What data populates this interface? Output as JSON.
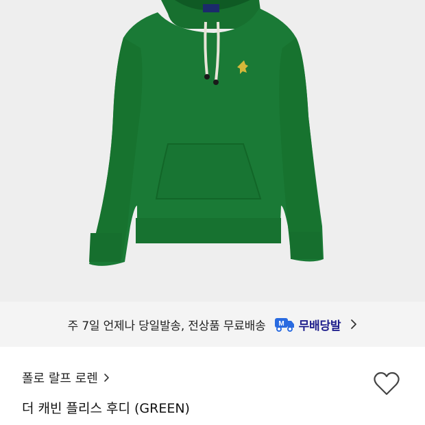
{
  "product_image": {
    "alt": "hoodie-photo",
    "background": "#eeeeee",
    "garment_color": "#1a7a36",
    "logo_color": "#d4b83a"
  },
  "shipping": {
    "text": "주 7일 언제나 당일발송, 전상품 무료배송",
    "badge_icon": "delivery-truck-icon",
    "badge_label": "무배당발",
    "badge_color": "#1e1e8c"
  },
  "product": {
    "brand": "폴로 랄프 로렌",
    "name": "더 캐빈 플리스 후디 (GREEN)"
  }
}
